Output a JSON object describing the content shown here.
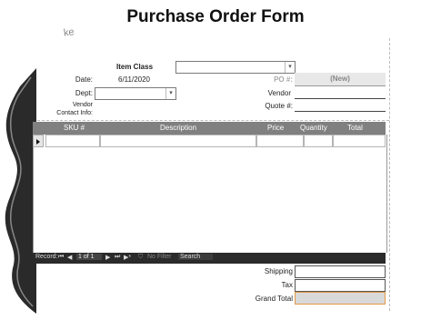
{
  "form": {
    "title": "Purchase Order Form",
    "scribble": "ke"
  },
  "header": {
    "item_class_label": "Item Class",
    "item_class_value": "",
    "date_label": "Date:",
    "date_value": "6/11/2020",
    "po_label": "PO #:",
    "po_value": "(New)",
    "dept_label": "Dept:",
    "dept_value": "",
    "vendor_label": "Vendor",
    "vendor_contact_label_1": "Vendor",
    "vendor_contact_label_2": "Contact Info:",
    "quote_label": "Quote #:"
  },
  "grid": {
    "columns": [
      "SKU #",
      "Description",
      "Price",
      "Quantity",
      "Total"
    ]
  },
  "nav": {
    "record_label": "Record:",
    "first": "⏮",
    "prev": "◀",
    "position": "1 of 1",
    "next": "▶",
    "last": "⏭",
    "new": "▶*",
    "filter_label": "No Filter",
    "search_label": "Search"
  },
  "totals": {
    "shipping_label": "Shipping",
    "tax_label": "Tax",
    "grand_total_label": "Grand Total"
  }
}
